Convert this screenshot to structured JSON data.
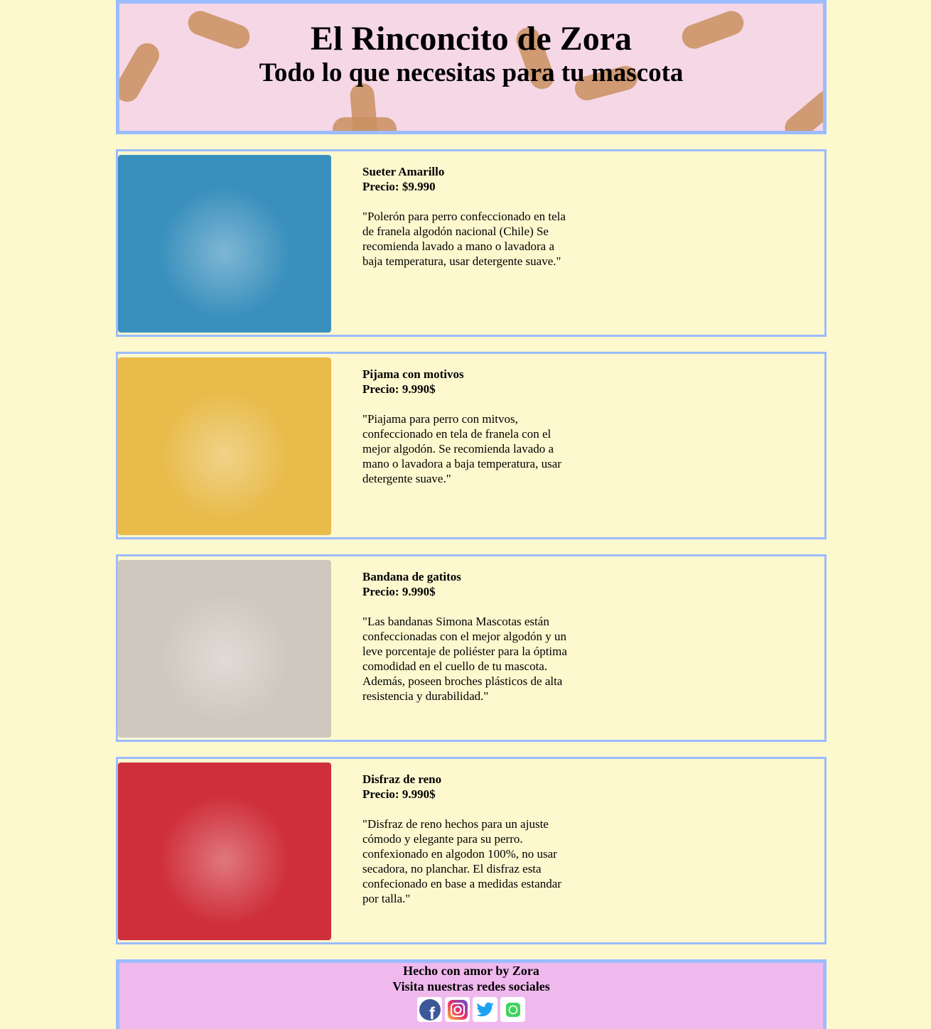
{
  "header": {
    "title": "El Rinconcito de Zora",
    "subtitle": "Todo lo que necesitas para tu mascota"
  },
  "products": [
    {
      "name": "Sueter Amarillo",
      "price": "Precio: $9.990",
      "description": "\"Polerón para perro confeccionado en tela de franela algodón nacional (Chile) Se recomienda lavado a mano o lavadora a baja temperatura, usar detergente suave.\"",
      "image_color": "#3a90bd"
    },
    {
      "name": "Pijama con motivos",
      "price": "Precio: 9.990$",
      "description": "\"Piajama para perro con mitvos, confeccionado en tela de franela con el mejor algodón. Se recomienda lavado a mano o lavadora a baja temperatura, usar detergente suave.\"",
      "image_color": "#e8bb4a"
    },
    {
      "name": "Bandana de gatitos",
      "price": "Precio: 9.990$",
      "description": "\"Las bandanas Simona Mascotas están confeccionadas con el mejor algodón y un leve porcentaje de poliéster para la óptima comodidad en el cuello de tu mascota. Además, poseen broches plásticos de alta resistencia y durabilidad.\"",
      "image_color": "#cfc8bf"
    },
    {
      "name": "Disfraz de reno",
      "price": "Precio: 9.990$",
      "description": "\"Disfraz de reno hechos para un ajuste cómodo y elegante para su perro. confexionado en algodon 100%, no usar secadora, no planchar. El disfraz esta confecionado en base a medidas estandar por talla.\"",
      "image_color": "#cf2f3a"
    }
  ],
  "footer": {
    "line1": "Hecho con amor by Zora",
    "line2": "Visita nuestras redes sociales"
  }
}
